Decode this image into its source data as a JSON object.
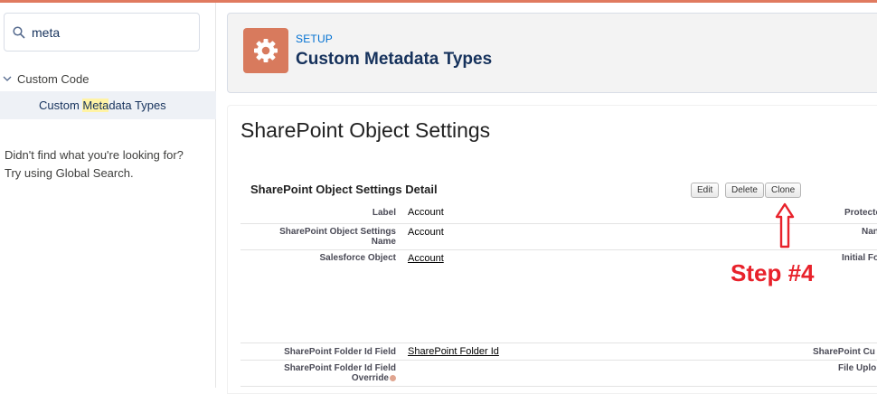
{
  "search": {
    "value": "meta"
  },
  "tree": {
    "group_label": "Custom Code",
    "item_prefix": "Custom ",
    "item_highlight": "Meta",
    "item_suffix": "data Types"
  },
  "sidebar_help": {
    "line1": "Didn't find what you're looking for?",
    "line2": "Try using Global Search."
  },
  "header": {
    "setup_label": "SETUP",
    "title": "Custom Metadata Types"
  },
  "content": {
    "title": "SharePoint Object Settings",
    "detail_title": "SharePoint Object Settings Detail",
    "buttons": {
      "edit": "Edit",
      "delete": "Delete",
      "clone": "Clone"
    },
    "fields": [
      {
        "label": "Label",
        "value": "Account",
        "right_label": "Protecte"
      },
      {
        "label": "SharePoint Object Settings Name",
        "value": "Account",
        "right_label": "Nan"
      },
      {
        "label": "Salesforce Object",
        "value": "Account",
        "right_label": "Initial Fo"
      },
      {
        "label": "SharePoint Folder Id Field",
        "value": "SharePoint Folder Id",
        "right_label": "SharePoint Cu"
      },
      {
        "label": "SharePoint Folder Id Field Override",
        "value": "",
        "right_label": "File Uplo"
      }
    ]
  },
  "annotation": {
    "text": "Step #4",
    "color": "#e8222b"
  },
  "colors": {
    "accent": "#0070d2",
    "gear_tile": "#d87a5d",
    "top_bar": "#e07a5f"
  },
  "icons": {
    "search": "search-icon",
    "chevron": "chevron-down-icon",
    "gear": "gear-icon",
    "help": "help-icon",
    "arrow": "arrow-up-icon"
  }
}
